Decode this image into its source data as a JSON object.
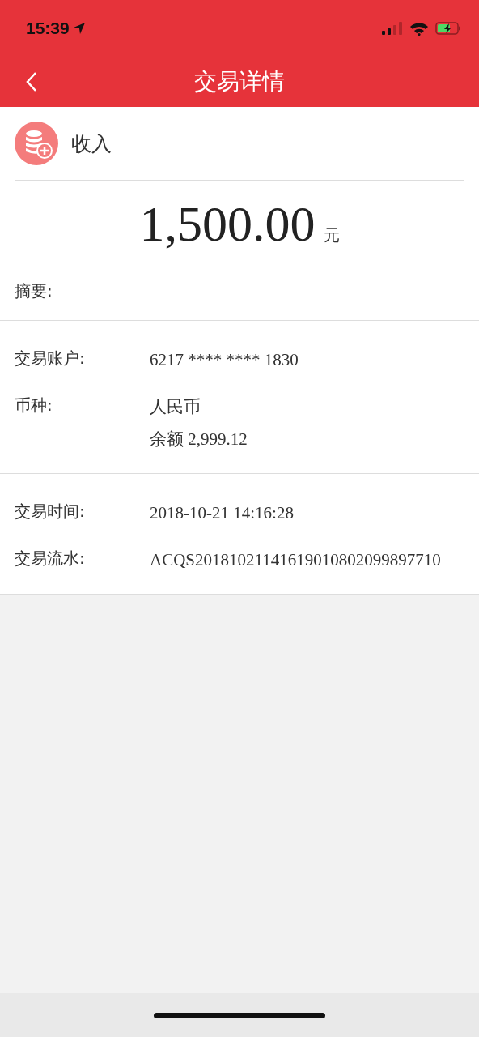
{
  "status_bar": {
    "time": "15:39"
  },
  "nav": {
    "title": "交易详情"
  },
  "summary": {
    "type": "收入",
    "amount": "1,500.00",
    "unit": "元",
    "memo_label": "摘要:"
  },
  "sections": [
    {
      "rows": [
        {
          "label": "交易账户:",
          "values": [
            "6217 **** **** 1830"
          ]
        },
        {
          "label": "币种:",
          "values": [
            "人民币",
            "余额 2,999.12"
          ]
        }
      ]
    },
    {
      "rows": [
        {
          "label": "交易时间:",
          "values": [
            "2018-10-21 14:16:28"
          ]
        },
        {
          "label": "交易流水:",
          "values": [
            "ACQS20181021141619010802099897710"
          ]
        }
      ]
    }
  ]
}
